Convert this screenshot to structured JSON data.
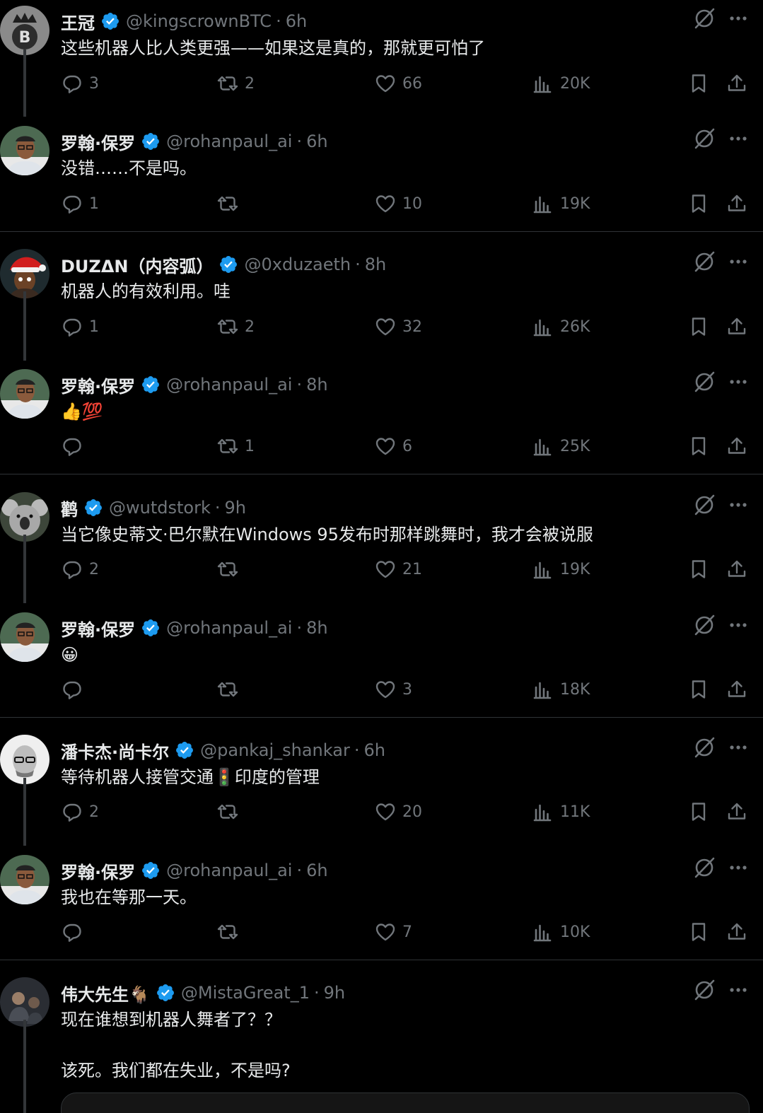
{
  "tweets": [
    {
      "name": "王冠",
      "handle": "@kingscrownBTC",
      "time": "6h",
      "text": "这些机器人比人类更强——如果这是真的，那就更可怕了",
      "replies": "3",
      "retweets": "2",
      "likes": "66",
      "views": "20K",
      "avatar": "bitcoin-crown-avatar"
    },
    {
      "name": "罗翰·保罗",
      "handle": "@rohanpaul_ai",
      "time": "6h",
      "text": "没错……不是吗。",
      "replies": "1",
      "retweets": "",
      "likes": "10",
      "views": "19K",
      "avatar": "man-glasses-avatar"
    },
    {
      "name": "DUZΔN（内容弧）",
      "handle": "@0xduzaeth",
      "time": "8h",
      "text": "机器人的有效利用。哇",
      "replies": "1",
      "retweets": "2",
      "likes": "32",
      "views": "26K",
      "avatar": "santa-hat-avatar"
    },
    {
      "name": "罗翰·保罗",
      "handle": "@rohanpaul_ai",
      "time": "8h",
      "text": "👍💯",
      "replies": "",
      "retweets": "1",
      "likes": "6",
      "views": "25K",
      "avatar": "man-glasses-avatar"
    },
    {
      "name": "鹳",
      "handle": "@wutdstork",
      "time": "9h",
      "text": "当它像史蒂文·巴尔默在Windows 95发布时那样跳舞时，我才会被说服",
      "replies": "2",
      "retweets": "",
      "likes": "21",
      "views": "19K",
      "avatar": "koala-avatar"
    },
    {
      "name": "罗翰·保罗",
      "handle": "@rohanpaul_ai",
      "time": "8h",
      "text": "😀",
      "replies": "",
      "retweets": "",
      "likes": "3",
      "views": "18K",
      "avatar": "man-glasses-avatar"
    },
    {
      "name": "潘卡杰·尚卡尔",
      "handle": "@pankaj_shankar",
      "time": "6h",
      "text": "等待机器人接管交通🚦印度的管理",
      "replies": "2",
      "retweets": "",
      "likes": "20",
      "views": "11K",
      "avatar": "bald-glasses-avatar"
    },
    {
      "name": "罗翰·保罗",
      "handle": "@rohanpaul_ai",
      "time": "6h",
      "text": "我也在等那一天。",
      "replies": "",
      "retweets": "",
      "likes": "7",
      "views": "10K",
      "avatar": "man-glasses-avatar"
    },
    {
      "name": "伟大先生🐐",
      "handle": "@MistaGreat_1",
      "time": "9h",
      "text": "现在谁想到机器人舞者了？？\n\n该死。我们都在失业，不是吗?",
      "replies": "",
      "retweets": "",
      "likes": "",
      "views": "",
      "avatar": "dark-photo-avatar"
    }
  ],
  "colors": {
    "background": "#000000",
    "text": "#e7e9ea",
    "muted": "#71767b",
    "verified": "#1d9bf0",
    "divider": "#2f3336"
  }
}
